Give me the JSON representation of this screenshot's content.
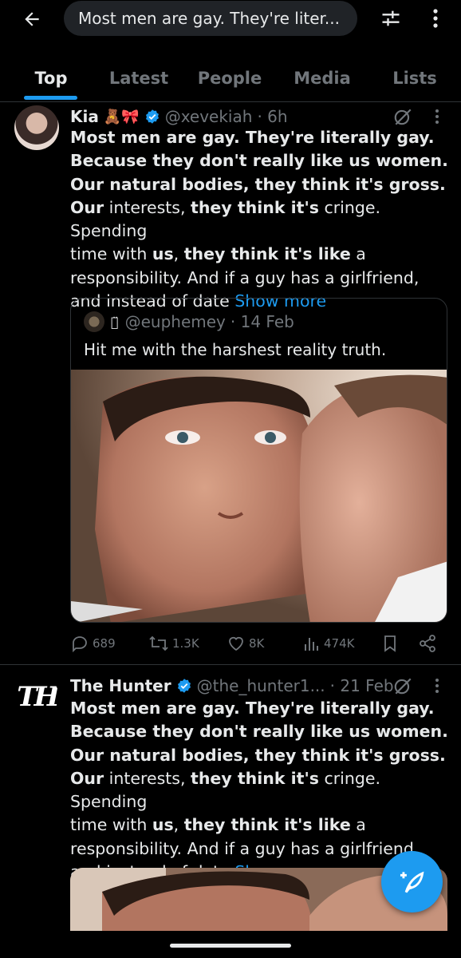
{
  "search": {
    "query": "Most men are gay. They're liter..."
  },
  "tabs": [
    {
      "label": "Top",
      "active": true
    },
    {
      "label": "Latest"
    },
    {
      "label": "People"
    },
    {
      "label": "Media"
    },
    {
      "label": "Lists"
    }
  ],
  "tweets": [
    {
      "name": "Kia",
      "emoji": "🧸🎀",
      "handle": "@xevekiah",
      "time": "· 6h",
      "body": {
        "l1": "Most men are gay. They're literally gay.",
        "l2": "Because they don't really like us women.",
        "l3": "Our natural bodies, they think it's gross.",
        "l4_b1": "Our",
        "l4_n1": " interests, ",
        "l4_b2": "they think it's",
        "l4_n2": " cringe. Spending",
        "l5_n1": "time with ",
        "l5_b1": "us",
        "l5_n2": ", ",
        "l5_b2": "they think it's like",
        "l5_n3": " a",
        "l6": "responsibility. And if a guy has a girlfriend,",
        "l7": "and instead of date ",
        "show_more": "Show more"
      },
      "quote": {
        "symbol": "⌒̈",
        "handle": "@euphemey",
        "time": "· 14 Feb",
        "text": "Hit me with the harshest reality truth."
      },
      "stats": {
        "replies": "689",
        "reposts": "1.3K",
        "likes": "8K",
        "views": "474K"
      }
    },
    {
      "name": "The Hunter",
      "avatar_text": "TH",
      "handle": "@the_hunter1...",
      "time": "· 21 Feb",
      "body": {
        "l1": "Most men are gay. They're literally gay.",
        "l2": "Because they don't really like us women.",
        "l3": "Our natural bodies, they think it's gross.",
        "l4_b1": "Our",
        "l4_n1": " interests, ",
        "l4_b2": "they think it's",
        "l4_n2": " cringe. Spending",
        "l5_n1": "time with ",
        "l5_b1": "us",
        "l5_n2": ", ",
        "l5_b2": "they think it's like",
        "l5_n3": " a",
        "l6": "responsibility. And if a guy has a girlfriend,",
        "l7": "and instead of date ",
        "show_more": "Show more"
      }
    }
  ],
  "colors": {
    "accent": "#1d9bf0",
    "background": "#000000",
    "muted": "#71767b",
    "divider": "#2f3336"
  },
  "icons": [
    "back-arrow-icon",
    "filter-sliders-icon",
    "more-vertical-icon",
    "verified-badge-icon",
    "grok-icon",
    "reply-icon",
    "repost-icon",
    "like-icon",
    "views-icon",
    "bookmark-icon",
    "share-icon",
    "compose-post-icon"
  ]
}
